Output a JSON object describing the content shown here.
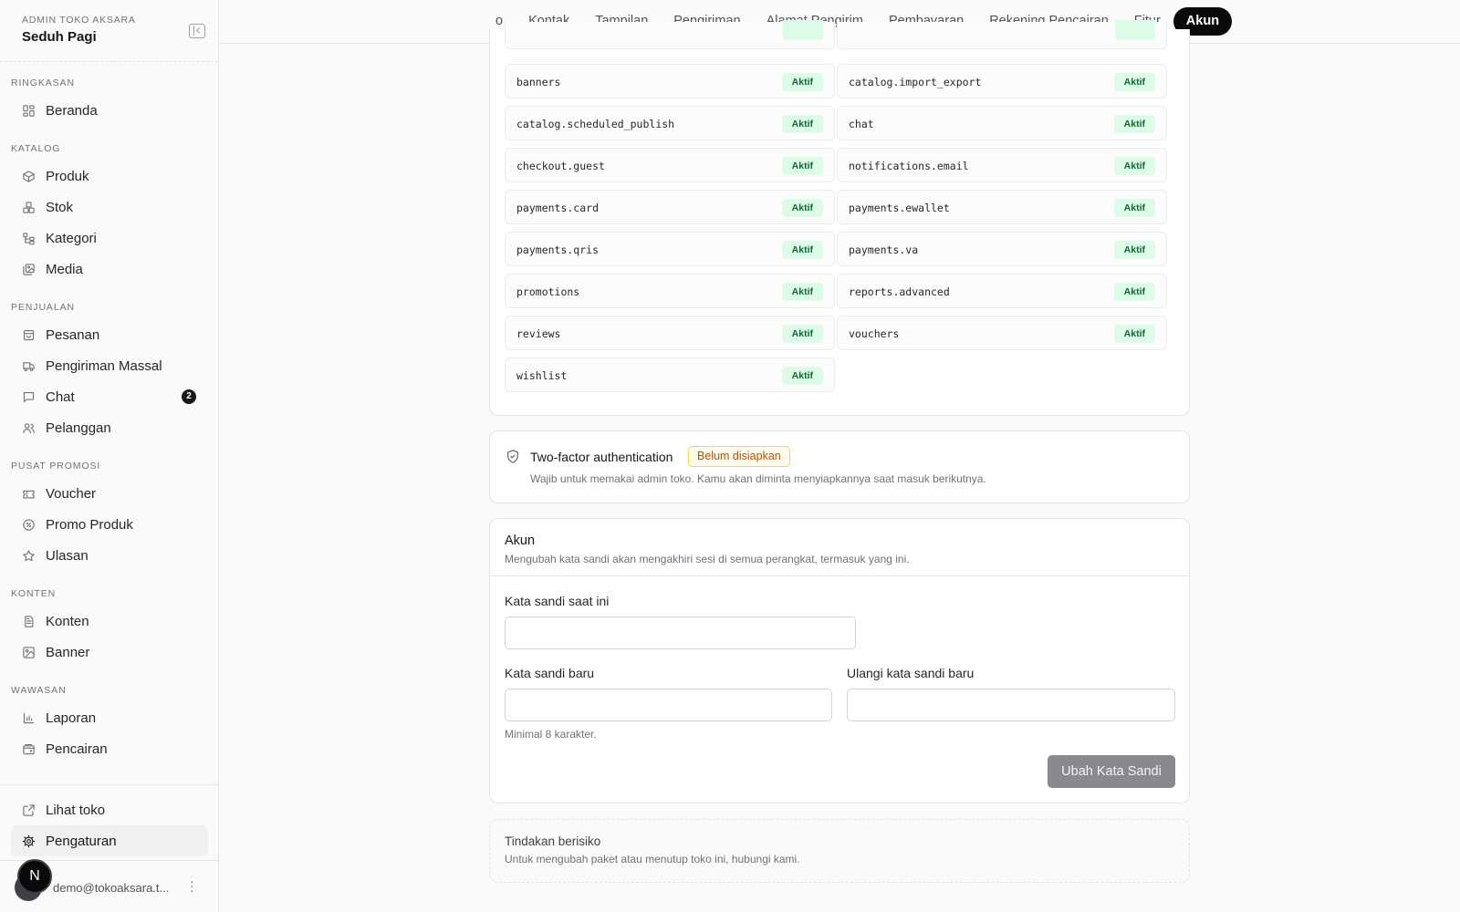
{
  "sidebar": {
    "brand_sub": "ADMIN TOKO AKSARA",
    "brand_name": "Seduh Pagi",
    "sections": [
      {
        "heading": "RINGKASAN",
        "items": [
          {
            "label": "Beranda",
            "icon": "grid-icon"
          }
        ]
      },
      {
        "heading": "KATALOG",
        "items": [
          {
            "label": "Produk",
            "icon": "box-icon"
          },
          {
            "label": "Stok",
            "icon": "boxes-icon"
          },
          {
            "label": "Kategori",
            "icon": "tree-icon"
          },
          {
            "label": "Media",
            "icon": "image-stack-icon"
          }
        ]
      },
      {
        "heading": "PENJUALAN",
        "items": [
          {
            "label": "Pesanan",
            "icon": "bag-icon"
          },
          {
            "label": "Pengiriman Massal",
            "icon": "truck-icon"
          },
          {
            "label": "Chat",
            "icon": "chat-icon",
            "badge": "2"
          },
          {
            "label": "Pelanggan",
            "icon": "users-icon"
          }
        ]
      },
      {
        "heading": "PUSAT PROMOSI",
        "items": [
          {
            "label": "Voucher",
            "icon": "ticket-icon"
          },
          {
            "label": "Promo Produk",
            "icon": "percent-icon"
          },
          {
            "label": "Ulasan",
            "icon": "star-icon"
          }
        ]
      },
      {
        "heading": "KONTEN",
        "items": [
          {
            "label": "Konten",
            "icon": "document-icon"
          },
          {
            "label": "Banner",
            "icon": "image-icon"
          }
        ]
      },
      {
        "heading": "WAWASAN",
        "items": [
          {
            "label": "Laporan",
            "icon": "bar-chart-icon"
          },
          {
            "label": "Pencairan",
            "icon": "wallet-icon"
          }
        ]
      }
    ],
    "bottom_items": [
      {
        "label": "Lihat toko",
        "icon": "external-link-icon"
      },
      {
        "label": "Pengaturan",
        "icon": "gear-icon",
        "active": true
      }
    ],
    "user": {
      "avatar_initial": "N",
      "email": "demo@tokoaksara.t..."
    }
  },
  "tabs": [
    "o",
    "Kontak",
    "Tampilan",
    "Pengiriman",
    "Alamat Pengirim",
    "Pembayaran",
    "Rekening Pencairan",
    "Fitur",
    "Akun"
  ],
  "active_tab": "Akun",
  "features": {
    "badge_label": "Aktif",
    "left": [
      "banners",
      "catalog.scheduled_publish",
      "checkout.guest",
      "payments.card",
      "payments.qris",
      "promotions",
      "reviews",
      "wishlist"
    ],
    "right": [
      "catalog.import_export",
      "chat",
      "notifications.email",
      "payments.ewallet",
      "payments.va",
      "reports.advanced",
      "vouchers"
    ]
  },
  "two_factor": {
    "title": "Two-factor authentication",
    "badge": "Belum disiapkan",
    "description": "Wajib untuk memakai admin toko. Kamu akan diminta menyiapkannya saat masuk berikutnya."
  },
  "account": {
    "title": "Akun",
    "description": "Mengubah kata sandi akan mengakhiri sesi di semua perangkat, termasuk yang ini.",
    "current_password_label": "Kata sandi saat ini",
    "current_password_value": "",
    "new_password_label": "Kata sandi baru",
    "new_password_value": "",
    "new_password_hint": "Minimal 8 karakter.",
    "repeat_password_label": "Ulangi kata sandi baru",
    "repeat_password_value": "",
    "submit_label": "Ubah Kata Sandi"
  },
  "danger": {
    "title": "Tindakan berisiko",
    "description": "Untuk mengubah paket atau menutup toko ini, hubungi kami."
  },
  "colors": {
    "accent": "#0a0a0a",
    "active_badge_bg": "#dcfce7",
    "active_badge_text": "#166534",
    "warning_badge_text": "#b45309",
    "disabled_button": "#8a8a8e"
  }
}
